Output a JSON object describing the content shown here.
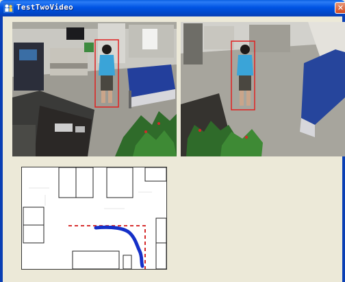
{
  "window": {
    "title": "TestTwoVideo",
    "close_glyph": "✕",
    "app_icon": "people-icon",
    "title_bar_color": "#0054e3",
    "client_background": "#ece9d8"
  },
  "videos": [
    {
      "name": "camera-1",
      "detection_box_color": "#e02020"
    },
    {
      "name": "camera-2",
      "detection_box_color": "#e02020"
    }
  ],
  "map": {
    "region_color": "#d01010",
    "trajectory_color": "#1530c8"
  }
}
